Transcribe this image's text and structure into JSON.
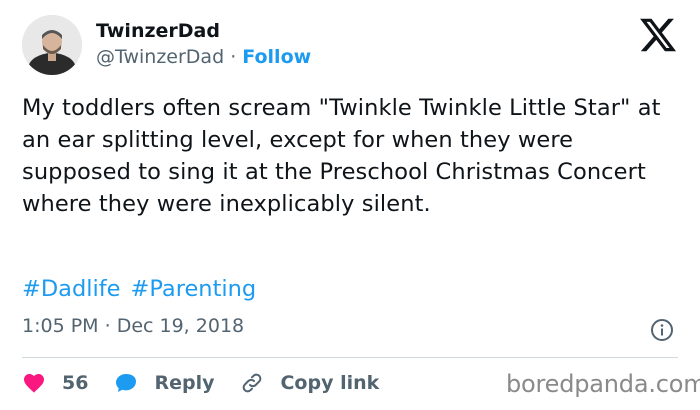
{
  "user": {
    "name": "TwinzerDad",
    "handle": "@TwinzerDad",
    "separator": "·",
    "follow_label": "Follow",
    "avatar": "avatar-photo"
  },
  "logo": "x-logo-icon",
  "tweet": {
    "text": "My toddlers often scream \"Twinkle Twinkle Little Star\" at an ear splitting level, except for when they were supposed to sing it at the Preschool Christmas Concert where they were inexplicably silent.",
    "hashtags": [
      "#Dadlife",
      "#Parenting"
    ],
    "time": "1:05 PM",
    "date_separator": "·",
    "date": "Dec 19, 2018"
  },
  "actions": {
    "like_count": "56",
    "reply_label": "Reply",
    "copy_link_label": "Copy link"
  },
  "colors": {
    "accent": "#1d9bf0",
    "like": "#f91880",
    "text": "#0f1419",
    "secondary": "#536471"
  },
  "watermark": "boredpanda.com"
}
